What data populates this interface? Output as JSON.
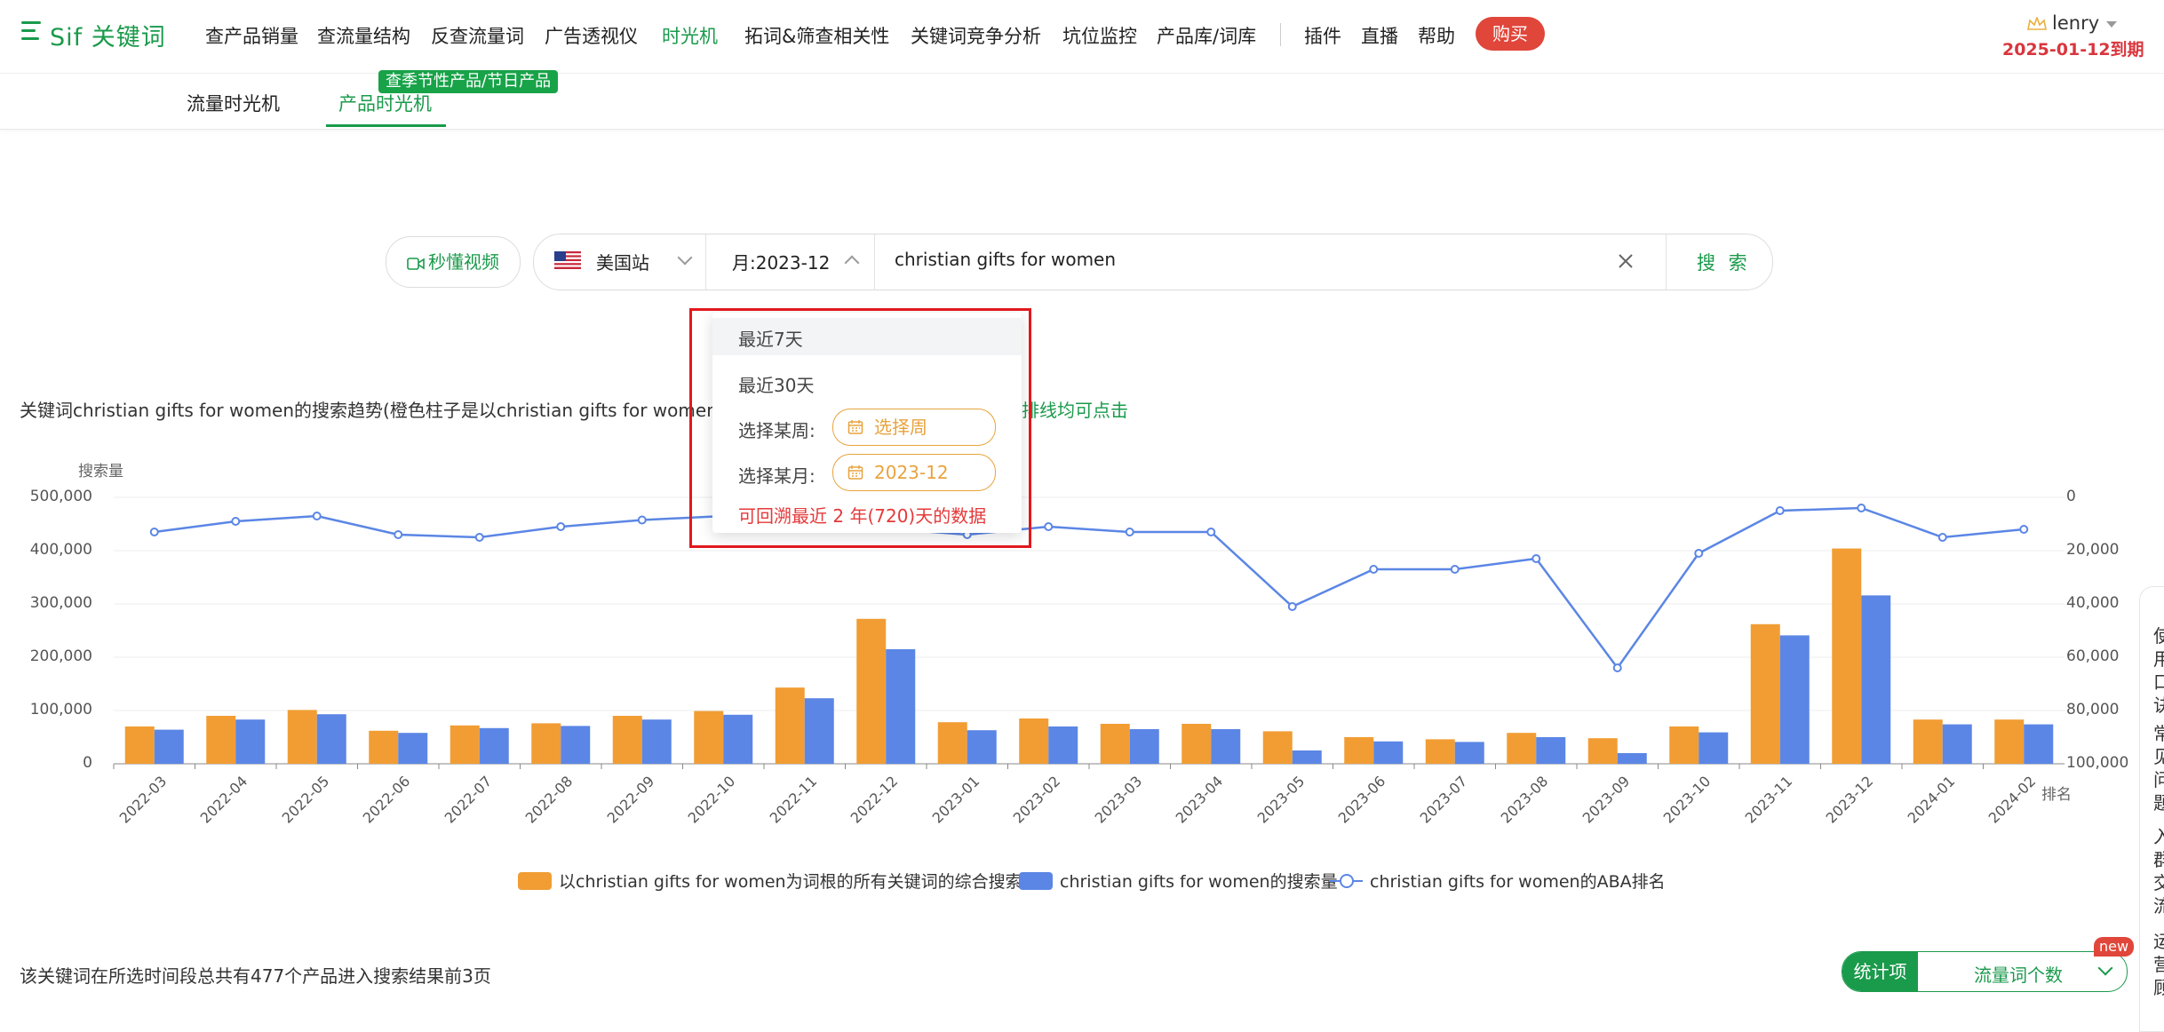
{
  "logo": "Sif 关键词",
  "nav": [
    {
      "label": "查产品销量",
      "left": 231
    },
    {
      "label": "查流量结构",
      "left": 357
    },
    {
      "label": "反查流量词",
      "left": 485
    },
    {
      "label": "广告透视仪",
      "left": 613
    },
    {
      "label": "时光机",
      "left": 745,
      "active": true
    },
    {
      "label": "拓词&筛查相关性",
      "left": 838
    },
    {
      "label": "关键词竞争分析",
      "left": 1025
    },
    {
      "label": "坑位监控",
      "left": 1196
    },
    {
      "label": "产品库/词库",
      "left": 1302
    },
    {
      "label": "插件",
      "left": 1468
    },
    {
      "label": "直播",
      "left": 1532
    },
    {
      "label": "帮助",
      "left": 1596
    }
  ],
  "buy_label": "购买",
  "user": {
    "name": "lenry",
    "expiry": "2025-01-12到期"
  },
  "subtabs": {
    "traffic": "流量时光机",
    "product": "产品时光机",
    "badge": "查季节性产品/节日产品"
  },
  "search": {
    "video_label": "秒懂视频",
    "site": "美国站",
    "month": "月:2023-12",
    "keyword": "christian gifts for women",
    "button": "搜 索"
  },
  "dropdown": {
    "last7": "最近7天",
    "last30": "最近30天",
    "week_label": "选择某周:",
    "week_placeholder": "选择周",
    "month_label": "选择某月:",
    "month_value": "2023-12",
    "note": "可回溯最近 2 年(720)天的数据"
  },
  "chart_title": {
    "prefix": "关键词christian gifts for women的搜索趋势(橙色柱子是以christian gifts for women为词",
    "tail": "排线均可点击"
  },
  "chart_data": {
    "type": "bar",
    "categories": [
      "2022-03",
      "2022-04",
      "2022-05",
      "2022-06",
      "2022-07",
      "2022-08",
      "2022-09",
      "2022-10",
      "2022-11",
      "2022-12",
      "2023-01",
      "2023-02",
      "2023-03",
      "2023-04",
      "2023-05",
      "2023-06",
      "2023-07",
      "2023-08",
      "2023-09",
      "2023-10",
      "2023-11",
      "2023-12",
      "2024-01",
      "2024-02"
    ],
    "series": [
      {
        "name": "以christian gifts for women为词根的所有关键词的综合搜索量",
        "color": "#f19d34",
        "type": "bar",
        "values": [
          70000,
          90000,
          101000,
          62000,
          72000,
          76000,
          90000,
          99000,
          143000,
          272000,
          78000,
          85000,
          75000,
          75000,
          61000,
          50000,
          46000,
          58000,
          48000,
          70000,
          262000,
          404000,
          83000,
          83000
        ]
      },
      {
        "name": "christian gifts for women的搜索量",
        "color": "#5b86e5",
        "type": "bar",
        "values": [
          64000,
          83000,
          93000,
          58000,
          67000,
          71000,
          83000,
          92000,
          123000,
          215000,
          63000,
          70000,
          65000,
          65000,
          25000,
          42000,
          41000,
          50000,
          20000,
          59000,
          241000,
          316000,
          74000,
          74000
        ]
      },
      {
        "name": "christian gifts for women的ABA排名",
        "color": "#5b86e5",
        "type": "line",
        "axis": "right",
        "values": [
          13000,
          9000,
          7000,
          14000,
          15000,
          11000,
          8500,
          7000,
          null,
          null,
          14000,
          11000,
          13000,
          13000,
          41000,
          27000,
          27000,
          23000,
          64000,
          21000,
          5000,
          4000,
          15000,
          12000
        ]
      }
    ],
    "ylabel_left": "搜索量",
    "ylabel_right": "排名",
    "ylim_left": [
      0,
      500000
    ],
    "ylim_right": [
      0,
      100000
    ],
    "right_axis_inverted": true,
    "yticks_left": [
      "500,000",
      "400,000",
      "300,000",
      "200,000",
      "100,000",
      "0"
    ],
    "yticks_right": [
      "0",
      "20,000",
      "40,000",
      "60,000",
      "80,000",
      "100,000"
    ],
    "grid": true,
    "legend_position": "bottom"
  },
  "footer": {
    "summary": "该关键词在所选时间段总共有477个产品进入搜索结果前3页",
    "stat_label": "统计项",
    "stat_value": "流量词个数",
    "new_badge": "new"
  },
  "side_chars": [
    "使",
    "用",
    "口",
    "诀",
    "常",
    "见",
    "问",
    "题",
    "入",
    "群",
    "交",
    "流",
    "运",
    "营",
    "顾"
  ]
}
